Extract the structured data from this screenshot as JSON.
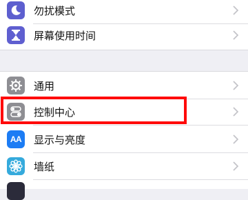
{
  "settings": {
    "items": [
      {
        "label": "勿扰模式",
        "icon": "moon-icon",
        "color": "#5d5fcf"
      },
      {
        "label": "屏幕使用时间",
        "icon": "hourglass-icon",
        "color": "#5f5fd0"
      },
      {
        "label": "通用",
        "icon": "gear-icon",
        "color": "#8e8e93"
      },
      {
        "label": "控制中心",
        "icon": "toggles-icon",
        "color": "#8e8e93"
      },
      {
        "label": "显示与亮度",
        "icon": "text-size-icon",
        "color": "#1c7cf4",
        "icon_text": "AA"
      },
      {
        "label": "墙纸",
        "icon": "flower-icon",
        "color": "#35aadc"
      }
    ]
  },
  "highlight": {
    "color": "#ff0a0a",
    "target": "控制中心"
  }
}
